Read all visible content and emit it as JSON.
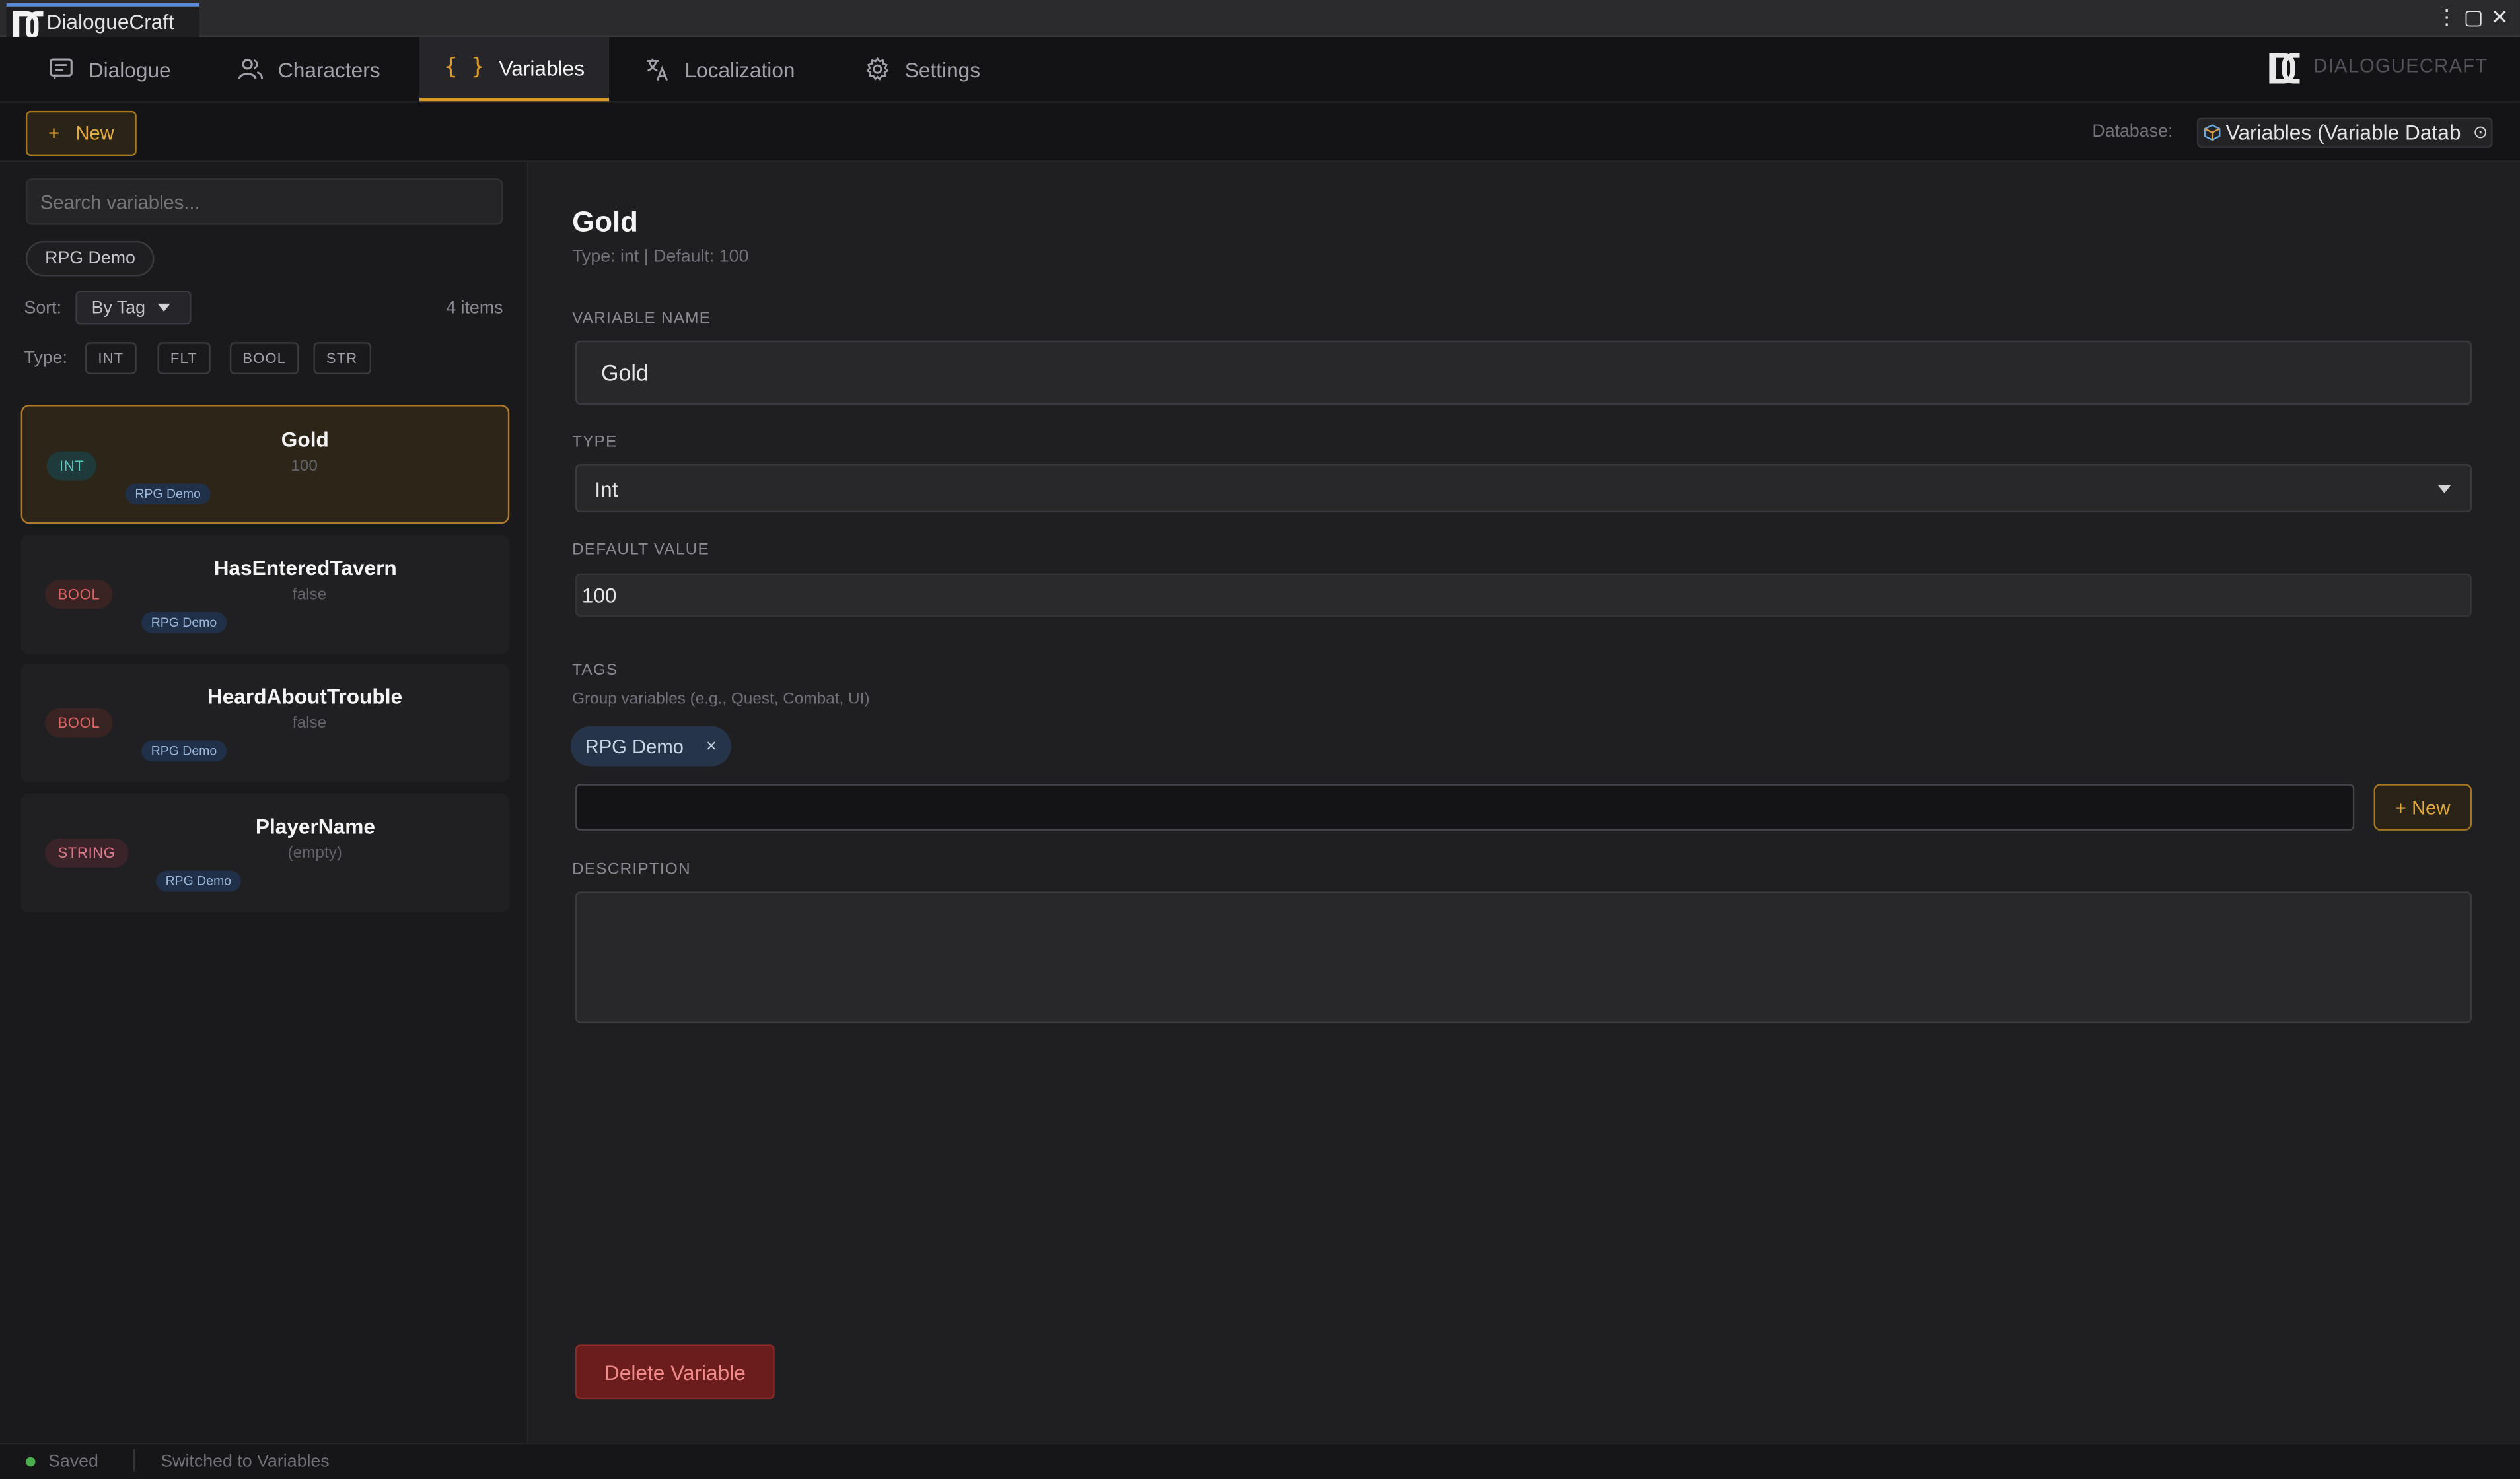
{
  "window": {
    "title": "DialogueCraft"
  },
  "nav": {
    "tabs": [
      {
        "label": "Dialogue",
        "icon": "chat-icon"
      },
      {
        "label": "Characters",
        "icon": "users-icon"
      },
      {
        "label": "Variables",
        "icon": "braces-icon",
        "active": true
      },
      {
        "label": "Localization",
        "icon": "translate-icon"
      },
      {
        "label": "Settings",
        "icon": "gear-icon"
      }
    ],
    "brand": "DIALOGUECRAFT"
  },
  "toolbar": {
    "new_label": "New",
    "new_icon": "+",
    "database_label": "Database:",
    "database_value": "Variables (Variable Datab"
  },
  "sidebar": {
    "search_placeholder": "Search variables...",
    "tag_filter": "RPG Demo",
    "sort_label": "Sort:",
    "sort_value": "By Tag",
    "count": "4 items",
    "type_label": "Type:",
    "type_filters": [
      "INT",
      "FLT",
      "BOOL",
      "STR"
    ],
    "variables": [
      {
        "type": "INT",
        "name": "Gold",
        "value": "100",
        "tag": "RPG Demo",
        "selected": true
      },
      {
        "type": "BOOL",
        "name": "HasEnteredTavern",
        "value": "false",
        "tag": "RPG Demo"
      },
      {
        "type": "BOOL",
        "name": "HeardAboutTrouble",
        "value": "false",
        "tag": "RPG Demo"
      },
      {
        "type": "STRING",
        "name": "PlayerName",
        "value": "(empty)",
        "tag": "RPG Demo"
      }
    ]
  },
  "detail": {
    "title": "Gold",
    "subtitle": "Type: int | Default: 100",
    "name_label": "VARIABLE NAME",
    "name_value": "Gold",
    "type_label": "TYPE",
    "type_value": "Int",
    "default_label": "DEFAULT VALUE",
    "default_value": "100",
    "tags_label": "TAGS",
    "tags_hint": "Group variables (e.g., Quest, Combat, UI)",
    "tags": [
      "RPG Demo"
    ],
    "tag_remove": "×",
    "tag_new_label": "+ New",
    "description_label": "DESCRIPTION",
    "description_value": "",
    "delete_label": "Delete Variable"
  },
  "status": {
    "saved": "Saved",
    "message": "Switched to Variables"
  },
  "colors": {
    "accent": "#d99a2b",
    "danger": "#6b1c1c",
    "int_badge": "#5ec8c0",
    "bool_badge": "#e26565",
    "tag_blue": "#26344a"
  }
}
